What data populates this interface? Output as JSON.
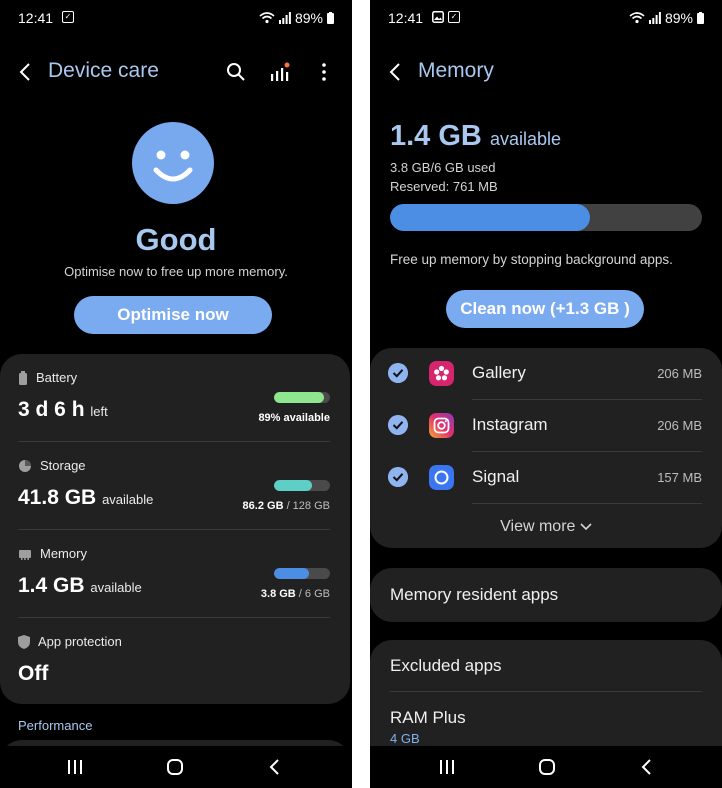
{
  "colors": {
    "accent": "#a9c8f0",
    "button": "#7aaaf0",
    "card": "#212121",
    "battery": "#8ee68e",
    "storage": "#5dcfc6",
    "memory": "#4c8ee4"
  },
  "left": {
    "status_bar": {
      "time": "12:41",
      "battery": "89%"
    },
    "title": "Device care",
    "status_word": "Good",
    "status_sub": "Optimise now to free up more memory.",
    "optimise_label": "Optimise now",
    "items": {
      "battery": {
        "label": "Battery",
        "value": "3 d 6 h",
        "unit": "left",
        "meta_bold": "89% available",
        "meta_rest": "",
        "fill": 0.89
      },
      "storage": {
        "label": "Storage",
        "value": "41.8 GB",
        "unit": "available",
        "meta_bold": "86.2 GB",
        "meta_rest": " / 128 GB",
        "fill": 0.67
      },
      "memory": {
        "label": "Memory",
        "value": "1.4 GB",
        "unit": "available",
        "meta_bold": "3.8 GB",
        "meta_rest": " / 6 GB",
        "fill": 0.63
      },
      "protection": {
        "label": "App protection",
        "value": "Off"
      }
    },
    "section_performance": "Performance"
  },
  "right": {
    "status_bar": {
      "time": "12:41",
      "battery": "89%"
    },
    "title": "Memory",
    "available_value": "1.4 GB",
    "available_unit": "available",
    "used": "3.8 GB/6 GB used",
    "reserved": "Reserved: 761 MB",
    "usage_fraction": 0.64,
    "description": "Free up memory by stopping background apps.",
    "clean_label": "Clean now (+1.3 GB )",
    "apps": [
      {
        "name": "Gallery",
        "size": "206 MB"
      },
      {
        "name": "Instagram",
        "size": "206 MB"
      },
      {
        "name": "Signal",
        "size": "157 MB"
      }
    ],
    "view_more": "View more",
    "resident_label": "Memory resident apps",
    "excluded_label": "Excluded apps",
    "ram_plus_label": "RAM Plus",
    "ram_plus_value": "4 GB"
  }
}
